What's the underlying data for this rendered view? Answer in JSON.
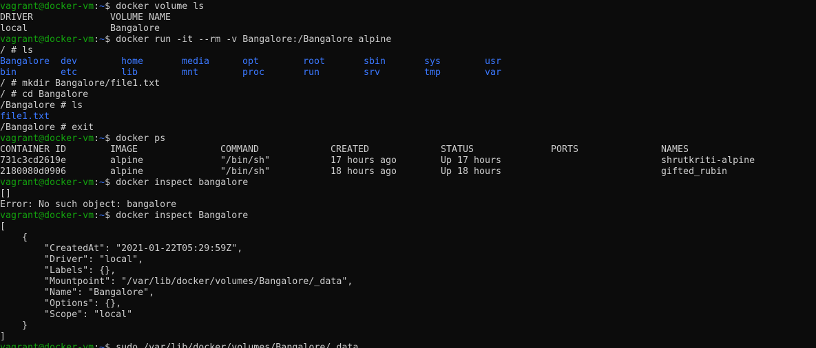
{
  "prompt": {
    "user": "vagrant@docker-vm",
    "path": "~",
    "symbol": "$"
  },
  "lines": [
    {
      "type": "prompt",
      "cmd": " docker volume ls"
    },
    {
      "type": "cols",
      "cols": [
        "DRIVER",
        "VOLUME NAME"
      ]
    },
    {
      "type": "cols",
      "cols": [
        "local",
        "Bangalore"
      ]
    },
    {
      "type": "prompt",
      "cmd": " docker run -it --rm -v Bangalore:/Bangalore alpine"
    },
    {
      "type": "text",
      "text": "/ # ls"
    },
    {
      "type": "dirs",
      "items": [
        "Bangalore",
        "dev",
        "home",
        "media",
        "opt",
        "root",
        "sbin",
        "sys",
        "usr"
      ]
    },
    {
      "type": "dirs",
      "items": [
        "bin",
        "etc",
        "lib",
        "mnt",
        "proc",
        "run",
        "srv",
        "tmp",
        "var"
      ]
    },
    {
      "type": "text",
      "text": "/ # mkdir Bangalore/file1.txt"
    },
    {
      "type": "text",
      "text": "/ # cd Bangalore"
    },
    {
      "type": "text",
      "text": "/Bangalore # ls"
    },
    {
      "type": "bluetext",
      "text": "file1.txt"
    },
    {
      "type": "text",
      "text": "/Bangalore # exit"
    },
    {
      "type": "prompt",
      "cmd": " docker ps"
    },
    {
      "type": "cols",
      "cols": [
        "CONTAINER ID",
        "IMAGE",
        "COMMAND",
        "CREATED",
        "STATUS",
        "PORTS",
        "NAMES"
      ]
    },
    {
      "type": "cols",
      "cols": [
        "731c3cd2619e",
        "alpine",
        "\"/bin/sh\"",
        "17 hours ago",
        "Up 17 hours",
        "",
        "shrutkriti-alpine"
      ]
    },
    {
      "type": "cols",
      "cols": [
        "2180080d0906",
        "alpine",
        "\"/bin/sh\"",
        "18 hours ago",
        "Up 18 hours",
        "",
        "gifted_rubin"
      ]
    },
    {
      "type": "prompt",
      "cmd": " docker inspect bangalore"
    },
    {
      "type": "text",
      "text": "[]"
    },
    {
      "type": "text",
      "text": "Error: No such object: bangalore"
    },
    {
      "type": "prompt",
      "cmd": " docker inspect Bangalore"
    },
    {
      "type": "text",
      "text": "["
    },
    {
      "type": "text",
      "text": "    {"
    },
    {
      "type": "text",
      "text": "        \"CreatedAt\": \"2021-01-22T05:29:59Z\","
    },
    {
      "type": "text",
      "text": "        \"Driver\": \"local\","
    },
    {
      "type": "text",
      "text": "        \"Labels\": {},"
    },
    {
      "type": "text",
      "text": "        \"Mountpoint\": \"/var/lib/docker/volumes/Bangalore/_data\","
    },
    {
      "type": "text",
      "text": "        \"Name\": \"Bangalore\","
    },
    {
      "type": "text",
      "text": "        \"Options\": {},"
    },
    {
      "type": "text",
      "text": "        \"Scope\": \"local\""
    },
    {
      "type": "text",
      "text": "    }"
    },
    {
      "type": "text",
      "text": "]"
    },
    {
      "type": "prompt",
      "cmd": " sudo /var/lib/docker/volumes/Bangalore/_data"
    }
  ]
}
